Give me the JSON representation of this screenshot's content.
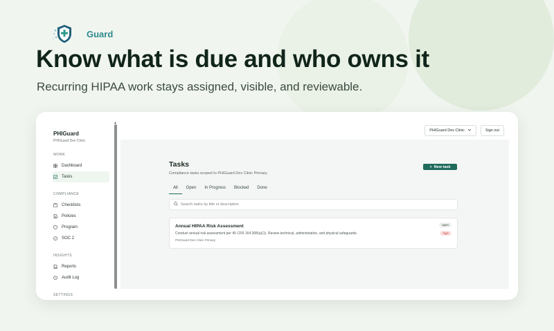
{
  "brand": {
    "name": "Guard"
  },
  "hero": {
    "headline": "Know what is due and who owns it",
    "subheadline": "Recurring HIPAA work stays assigned, visible, and reviewable."
  },
  "app": {
    "sidebar": {
      "title": "PHIGuard",
      "org": "PHIGuard Dev Clinic",
      "sections": [
        {
          "label": "WORK",
          "items": [
            {
              "label": "Dashboard",
              "icon": "grid-icon"
            },
            {
              "label": "Tasks",
              "icon": "check-square-icon",
              "active": true
            }
          ]
        },
        {
          "label": "COMPLIANCE",
          "items": [
            {
              "label": "Checklists",
              "icon": "clipboard-icon"
            },
            {
              "label": "Policies",
              "icon": "document-icon"
            },
            {
              "label": "Program",
              "icon": "shield-icon"
            },
            {
              "label": "SOC 2",
              "icon": "badge-icon"
            }
          ]
        },
        {
          "label": "INSIGHTS",
          "items": [
            {
              "label": "Reports",
              "icon": "chart-icon"
            },
            {
              "label": "Audit Log",
              "icon": "history-icon"
            }
          ]
        },
        {
          "label": "SETTINGS",
          "items": []
        }
      ]
    },
    "topbar": {
      "org_select": "PHIGuard Dev Clinic",
      "sign_out": "Sign out"
    },
    "tasks": {
      "title": "Tasks",
      "subtitle": "Compliance tasks scoped to PHIGuard Dev Clinic Primary.",
      "new_task": "New task",
      "tabs": [
        "All",
        "Open",
        "In Progress",
        "Blocked",
        "Done"
      ],
      "active_tab": "All",
      "search_placeholder": "Search tasks by title or description",
      "items": [
        {
          "title": "Annual HIPAA Risk Assessment",
          "description": "Conduct annual risk assessment per 45 CFR 164.308(a)(1). Review technical, administrative, and physical safeguards.",
          "org": "PHIGuard Dev Clinic Primary",
          "status": "open",
          "priority": "high"
        }
      ]
    }
  },
  "colors": {
    "accent": "#1f6b5c",
    "brand": "#2c8a8f",
    "high": "#c0392b"
  }
}
